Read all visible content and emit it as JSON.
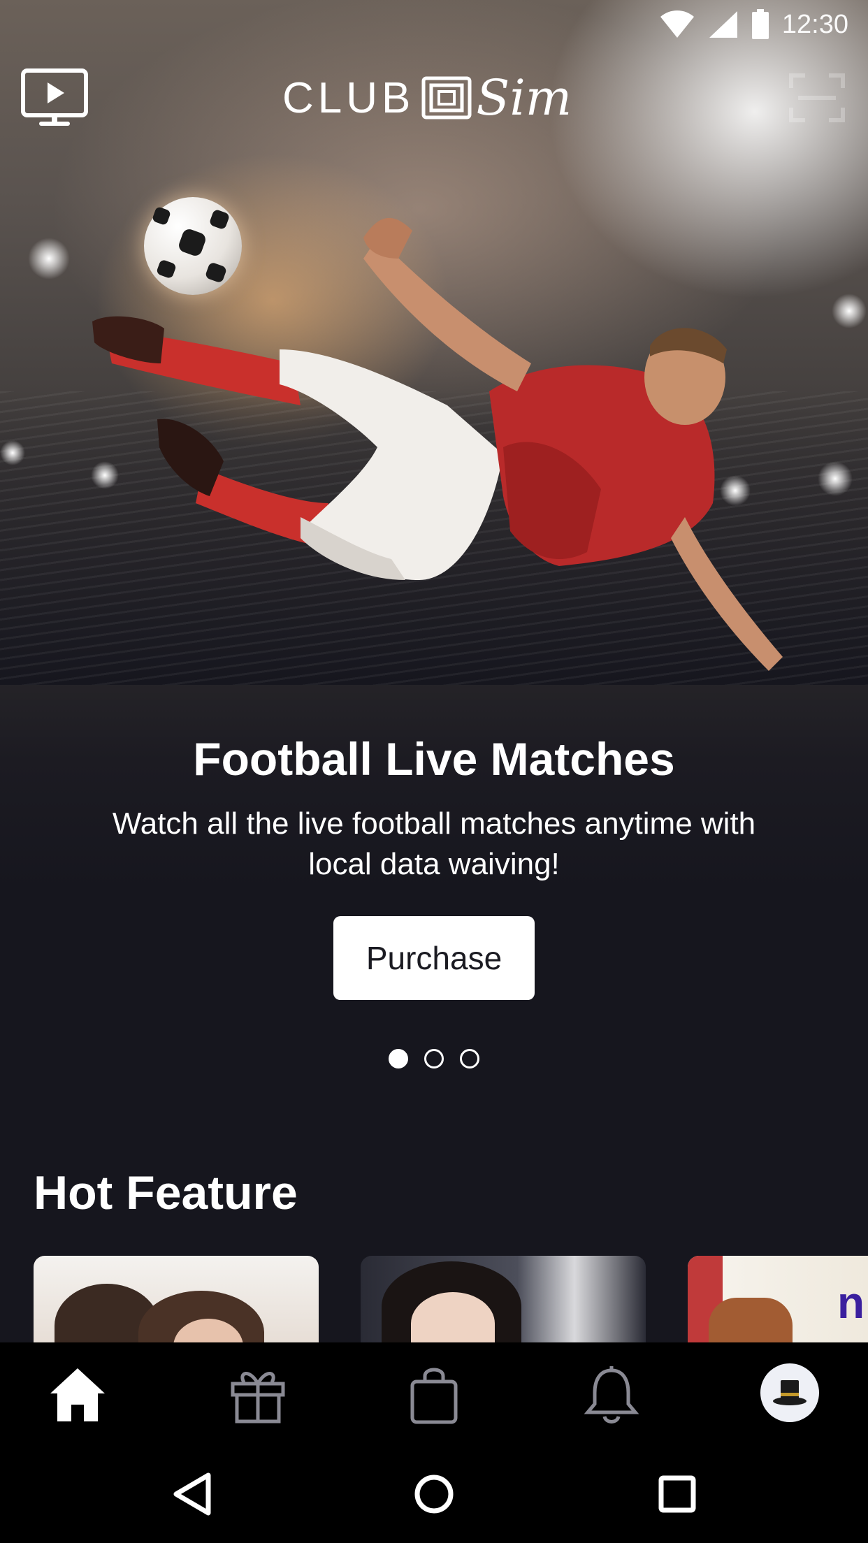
{
  "status_bar": {
    "time": "12:30",
    "icons": [
      "wifi-icon",
      "cellular-signal-icon",
      "battery-icon"
    ]
  },
  "header": {
    "logo_text_left": "CLUB",
    "logo_text_right": "Sim",
    "left_icon": "tv-play-icon",
    "right_icon": "scan-icon"
  },
  "hero": {
    "title": "Football Live Matches",
    "subtitle": "Watch all the live football matches anytime with local data waiving!",
    "button_label": "Purchase",
    "carousel_total": 3,
    "carousel_active": 1
  },
  "hot_feature": {
    "title": "Hot Feature",
    "cards": [
      {
        "name": "feature-card-1"
      },
      {
        "name": "feature-card-2"
      },
      {
        "name": "feature-card-3",
        "brand_text": "n"
      }
    ]
  },
  "bottom_nav": {
    "items": [
      {
        "name": "home",
        "icon": "home-icon",
        "active": true
      },
      {
        "name": "rewards",
        "icon": "gift-icon",
        "active": false
      },
      {
        "name": "shop",
        "icon": "shopping-bag-icon",
        "active": false
      },
      {
        "name": "notifications",
        "icon": "bell-icon",
        "active": false
      },
      {
        "name": "profile",
        "icon": "avatar-icon",
        "active": false
      }
    ]
  },
  "system_nav": {
    "icons": [
      "back-icon",
      "home-circle-icon",
      "recents-icon"
    ]
  },
  "colors": {
    "background": "#16161e",
    "nav_bar": "#000000",
    "button_bg": "#ffffff",
    "accent_text": "#ffffff"
  }
}
